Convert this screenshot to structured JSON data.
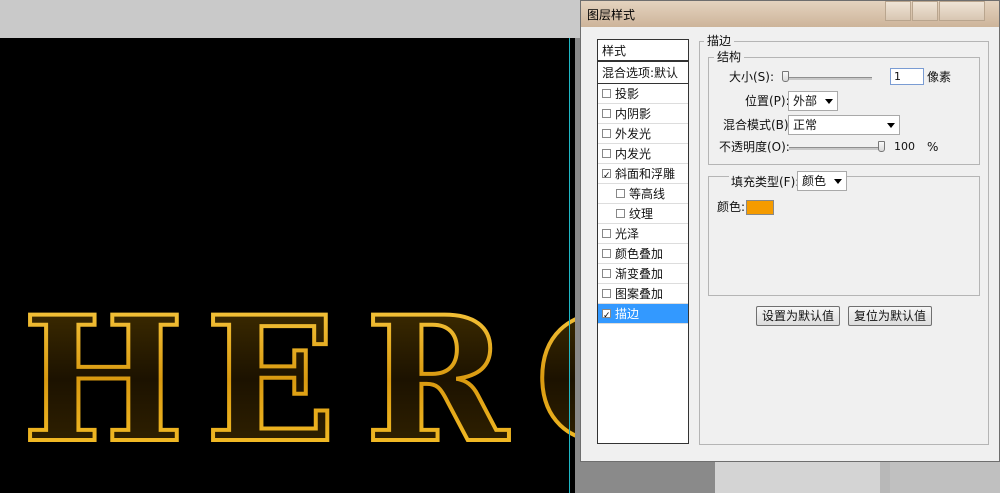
{
  "canvas": {
    "text": "HERO",
    "letters": [
      "H",
      "E",
      "R",
      "O"
    ],
    "text_color": "#e8b020",
    "background": "#000000"
  },
  "dialog": {
    "title": "图层样式",
    "style_list": {
      "header": "样式",
      "blend_options": "混合选项:默认",
      "items": [
        {
          "label": "投影",
          "checked": false,
          "sub": false,
          "selected": false
        },
        {
          "label": "内阴影",
          "checked": false,
          "sub": false,
          "selected": false
        },
        {
          "label": "外发光",
          "checked": false,
          "sub": false,
          "selected": false
        },
        {
          "label": "内发光",
          "checked": false,
          "sub": false,
          "selected": false
        },
        {
          "label": "斜面和浮雕",
          "checked": true,
          "sub": false,
          "selected": false
        },
        {
          "label": "等高线",
          "checked": false,
          "sub": true,
          "selected": false
        },
        {
          "label": "纹理",
          "checked": false,
          "sub": true,
          "selected": false
        },
        {
          "label": "光泽",
          "checked": false,
          "sub": false,
          "selected": false
        },
        {
          "label": "颜色叠加",
          "checked": false,
          "sub": false,
          "selected": false
        },
        {
          "label": "渐变叠加",
          "checked": false,
          "sub": false,
          "selected": false
        },
        {
          "label": "图案叠加",
          "checked": false,
          "sub": false,
          "selected": false
        },
        {
          "label": "描边",
          "checked": true,
          "sub": false,
          "selected": true
        }
      ]
    },
    "stroke": {
      "group_title": "描边",
      "structure_title": "结构",
      "size_label": "大小(S):",
      "size_value": "1",
      "size_unit": "像素",
      "position_label": "位置(P):",
      "position_value": "外部",
      "blend_mode_label": "混合模式(B):",
      "blend_mode_value": "正常",
      "opacity_label": "不透明度(O):",
      "opacity_value": "100",
      "opacity_unit": "%",
      "size_slider_level": 0.0,
      "opacity_slider_level": 1.0,
      "fill_type_label": "填充类型(F):",
      "fill_type_value": "颜色",
      "color_label": "颜色:",
      "color_value": "#f59b00",
      "set_default_button": "设置为默认值",
      "reset_default_button": "复位为默认值"
    }
  }
}
